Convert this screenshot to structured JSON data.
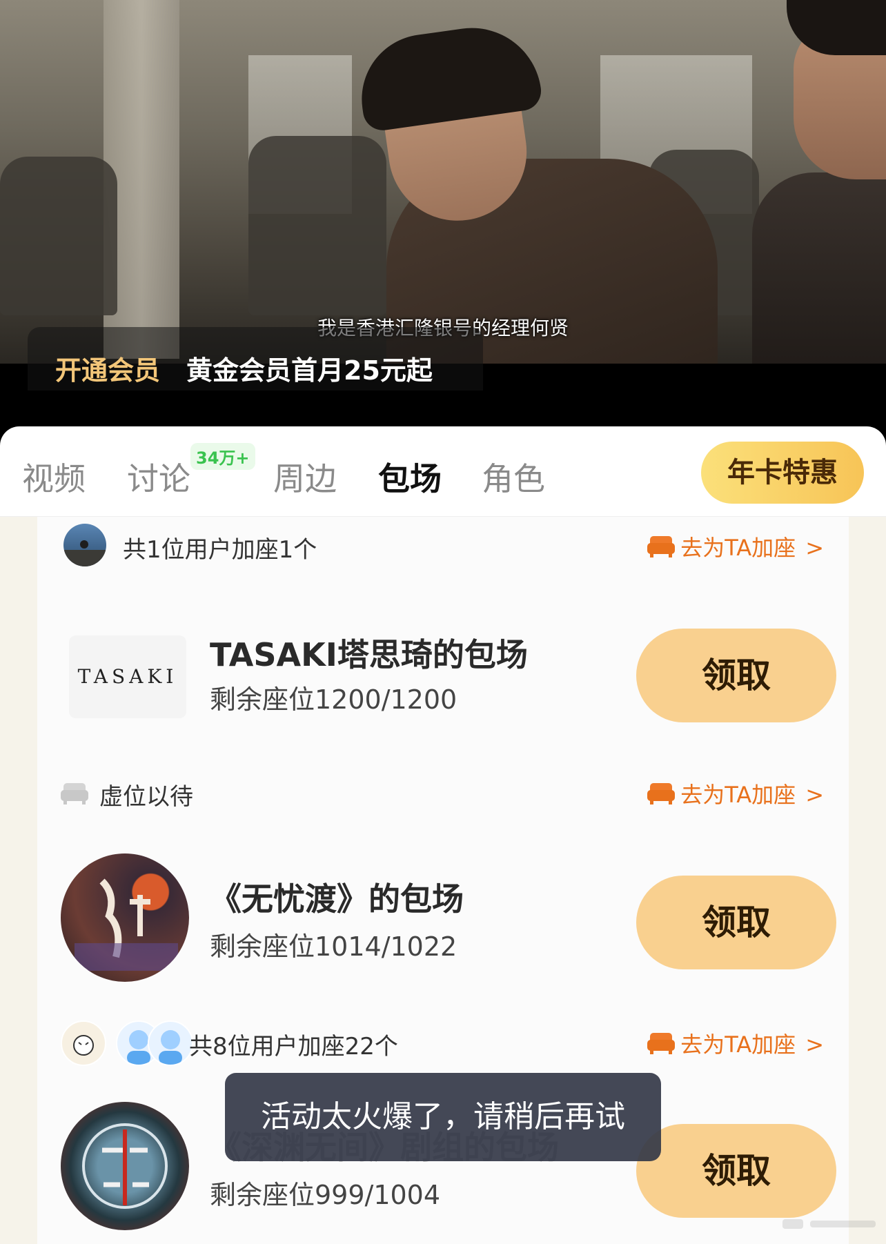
{
  "video": {
    "subtitle": "我是香港汇隆银号的经理何贤",
    "vip_open_label": "开通会员",
    "vip_promo_text": "黄金会员首月25元起"
  },
  "tabs": {
    "items": [
      {
        "label": "视频"
      },
      {
        "label": "讨论"
      },
      {
        "label": "周边"
      },
      {
        "label": "包场"
      },
      {
        "label": "角色"
      }
    ],
    "discuss_badge": "34万+",
    "annual_button": "年卡特惠"
  },
  "list": {
    "top_row": {
      "text": "共1位用户加座1个",
      "goto": "去为TA加座",
      "chevron": ">"
    },
    "cards": [
      {
        "title": "TASAKI塔思琦的包场",
        "seats": "剩余座位1200/1200",
        "claim": "领取",
        "logo_text": "TASAKI",
        "foot_text": "虚位以待",
        "foot_goto": "去为TA加座",
        "foot_chevron": ">"
      },
      {
        "title": "《无忧渡》的包场",
        "seats": "剩余座位1014/1022",
        "claim": "领取",
        "thumb_icon": "wuyoudu-poster-icon",
        "foot_text": "共8位用户加座22个",
        "foot_goto": "去为TA加座",
        "foot_chevron": ">"
      },
      {
        "title": "《深渊无间》剧组的包场",
        "seats": "剩余座位999/1004",
        "claim": "领取",
        "thumb_icon": "shenyuan-poster-icon"
      }
    ]
  },
  "toast": {
    "text": "活动太火爆了，请稍后再试"
  },
  "colors": {
    "accent_orange": "#e8711c",
    "claim_button": "#f9d08f",
    "vip_gold": "#f3c679",
    "badge_green": "#3ac34f"
  }
}
